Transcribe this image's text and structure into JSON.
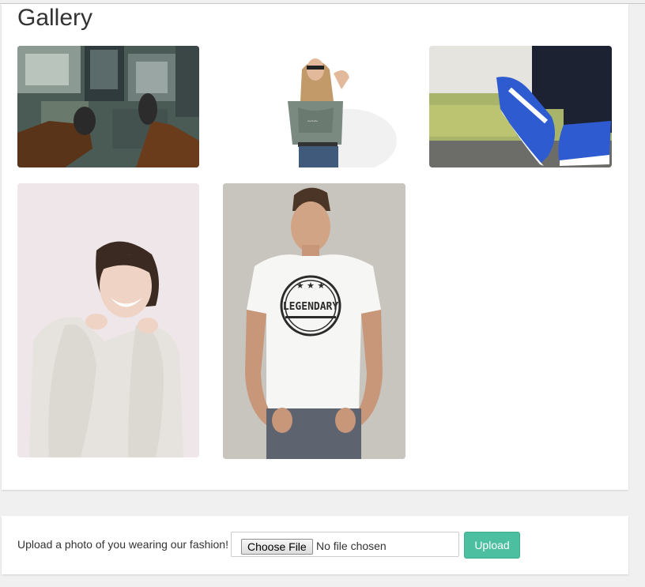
{
  "gallery": {
    "title": "Gallery",
    "photos": [
      {
        "name": "photo-feet-over-city"
      },
      {
        "name": "photo-woman-sunglasses-tshirt"
      },
      {
        "name": "photo-blue-sneakers"
      },
      {
        "name": "photo-smiling-woman-sweater"
      },
      {
        "name": "photo-man-legendary-tshirt",
        "shirt_text": "LEGENDARY"
      }
    ]
  },
  "upload": {
    "label": "Upload a photo of you wearing our fashion!",
    "choose_file_label": "Choose File",
    "no_file_text": "No file chosen",
    "upload_button_label": "Upload"
  },
  "colors": {
    "accent": "#4bbf9f",
    "page_bg": "#f0f0f0",
    "card_bg": "#ffffff",
    "text": "#333333"
  }
}
